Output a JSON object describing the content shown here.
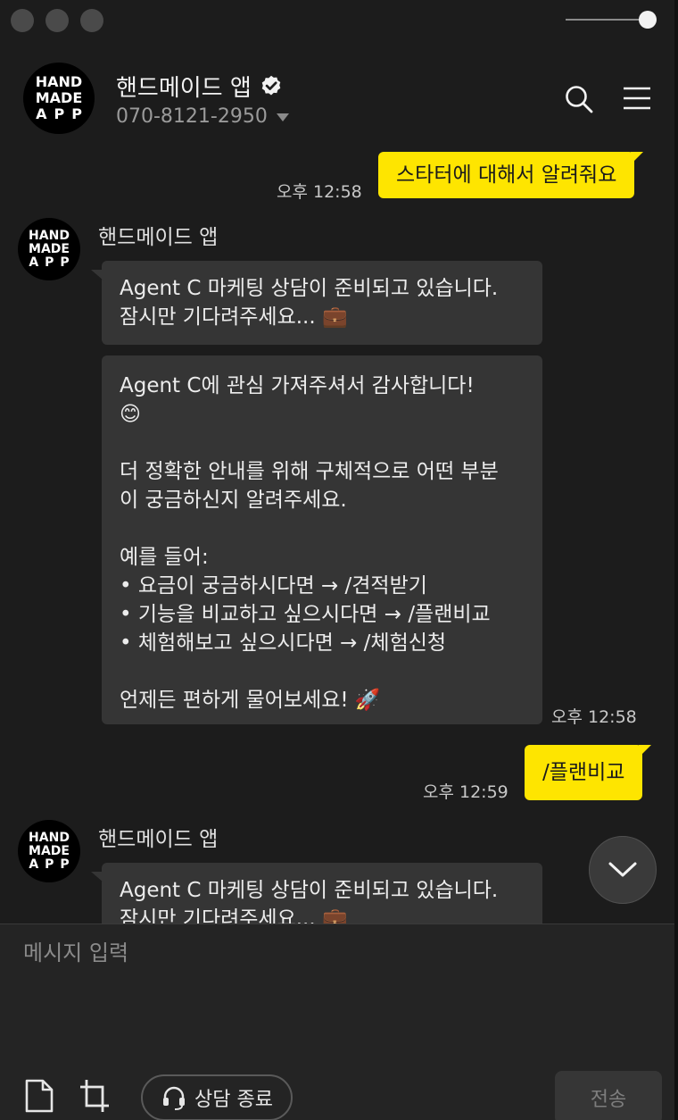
{
  "header": {
    "logo_lines": [
      "HAND",
      "MADE",
      "APP"
    ],
    "name": "핸드메이드 앱",
    "phone": "070-8121-2950",
    "icons": [
      "verified-badge-icon",
      "search-icon",
      "menu-icon"
    ]
  },
  "chat": {
    "messages": [
      {
        "from": "me",
        "text": "스타터에 대해서 알려줘요",
        "time": "오후 12:58"
      },
      {
        "from": "them",
        "sender": "핸드메이드 앱",
        "lines": [
          "Agent C 마케팅 상담이 준비되고 있습니다.",
          "잠시만 기다려주세요... 💼"
        ]
      },
      {
        "from": "them",
        "lines": [
          "Agent C에 관심 가져주셔서 감사합니다!",
          "😊",
          "",
          "더 정확한 안내를 위해 구체적으로 어떤 부분",
          "이 궁금하신지 알려주세요.",
          "",
          "예를 들어:",
          "• 요금이 궁금하시다면 → /견적받기",
          "• 기능을 비교하고 싶으시다면 → /플랜비교",
          "• 체험해보고 싶으시다면 → /체험신청",
          "",
          "언제든 편하게 물어보세요! 🚀"
        ],
        "time": "오후 12:58"
      },
      {
        "from": "me",
        "text": "/플랜비교",
        "time": "오후 12:59"
      },
      {
        "from": "them",
        "sender": "핸드메이드 앱",
        "lines": [
          "Agent C 마케팅 상담이 준비되고 있습니다.",
          "잠시만 기다려주세요... 💼"
        ]
      }
    ]
  },
  "composer": {
    "placeholder": "메시지 입력",
    "end_chat_label": "상담 종료",
    "send_label": "전송"
  },
  "colors": {
    "background": "#1c1c1c",
    "my_bubble": "#fee500",
    "their_bubble": "#353535",
    "composer": "#242424"
  }
}
